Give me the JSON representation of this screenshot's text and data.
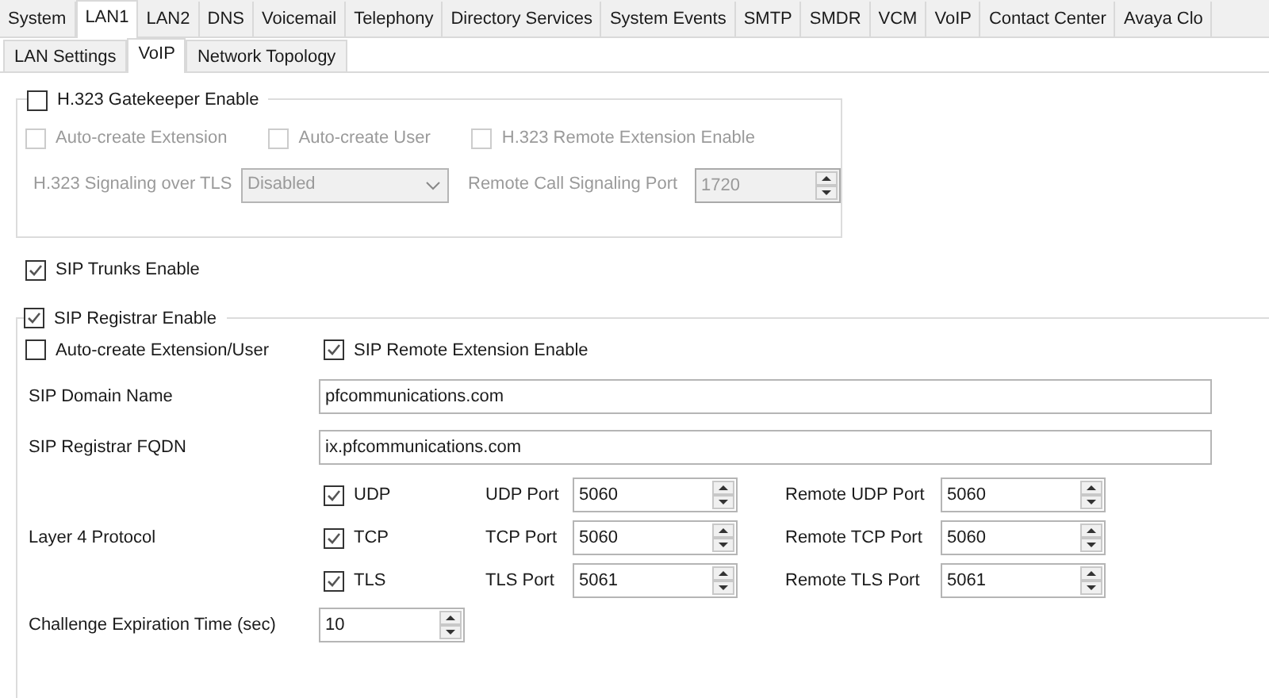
{
  "tabs": [
    {
      "label": "System",
      "selected": false
    },
    {
      "label": "LAN1",
      "selected": true
    },
    {
      "label": "LAN2",
      "selected": false
    },
    {
      "label": "DNS",
      "selected": false
    },
    {
      "label": "Voicemail",
      "selected": false
    },
    {
      "label": "Telephony",
      "selected": false
    },
    {
      "label": "Directory Services",
      "selected": false
    },
    {
      "label": "System Events",
      "selected": false
    },
    {
      "label": "SMTP",
      "selected": false
    },
    {
      "label": "SMDR",
      "selected": false
    },
    {
      "label": "VCM",
      "selected": false
    },
    {
      "label": "VoIP",
      "selected": false
    },
    {
      "label": "Contact Center",
      "selected": false
    },
    {
      "label": "Avaya Clo",
      "selected": false
    }
  ],
  "subtabs": [
    {
      "label": "LAN Settings",
      "selected": false
    },
    {
      "label": "VoIP",
      "selected": true
    },
    {
      "label": "Network Topology",
      "selected": false
    }
  ],
  "h323": {
    "enable": {
      "label": "H.323 Gatekeeper Enable",
      "checked": false
    },
    "disabled": true,
    "options": [
      {
        "label": "Auto-create Extension",
        "checked": false
      },
      {
        "label": "Auto-create User",
        "checked": false
      },
      {
        "label": "H.323 Remote Extension Enable",
        "checked": false
      }
    ],
    "signaling": {
      "label": "H.323 Signaling over TLS",
      "value": "Disabled"
    },
    "port": {
      "label": "Remote Call Signaling Port",
      "value": "1720"
    }
  },
  "sip_trunks": {
    "label": "SIP Trunks Enable",
    "checked": true
  },
  "sip_registrar": {
    "enable": {
      "label": "SIP Registrar Enable",
      "checked": true
    },
    "options": [
      {
        "label": "Auto-create Extension/User",
        "checked": false
      },
      {
        "label": "SIP Remote Extension Enable",
        "checked": true
      }
    ],
    "domain": {
      "label": "SIP Domain Name",
      "value": "pfcommunications.com"
    },
    "fqdn": {
      "label": "SIP Registrar FQDN",
      "value": "ix.pfcommunications.com"
    },
    "layer4": {
      "label": "Layer 4 Protocol",
      "protocols": [
        {
          "label": "UDP",
          "checked": true,
          "port_label": "UDP Port",
          "port": "5060",
          "remote_label": "Remote UDP Port",
          "remote": "5060"
        },
        {
          "label": "TCP",
          "checked": true,
          "port_label": "TCP Port",
          "port": "5060",
          "remote_label": "Remote TCP Port",
          "remote": "5060"
        },
        {
          "label": "TLS",
          "checked": true,
          "port_label": "TLS Port",
          "port": "5061",
          "remote_label": "Remote TLS Port",
          "remote": "5061"
        }
      ]
    },
    "challenge": {
      "label": "Challenge Expiration Time (sec)",
      "value": "10"
    }
  }
}
